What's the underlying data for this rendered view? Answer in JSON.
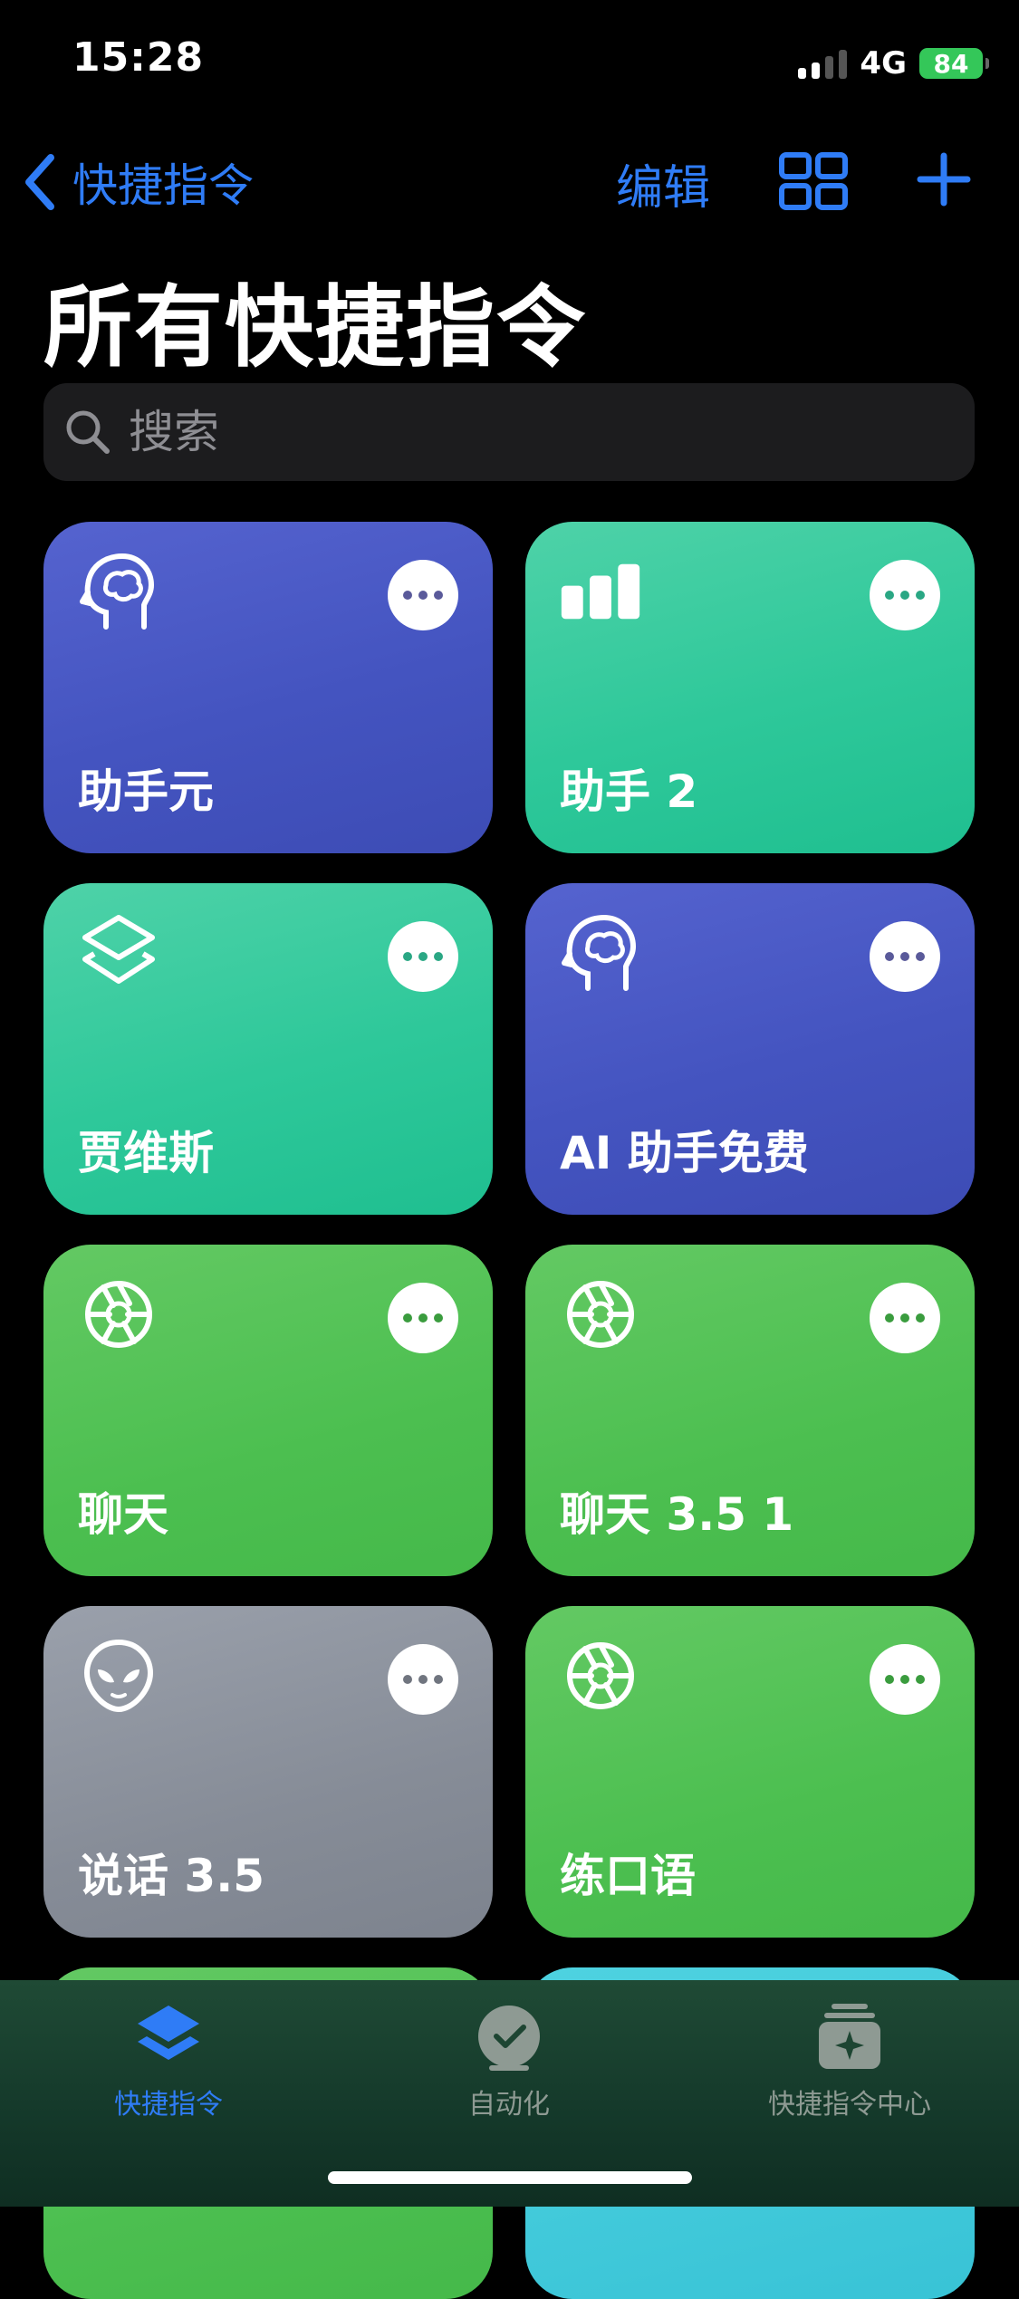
{
  "status": {
    "time": "15:28",
    "network": "4G",
    "battery": "84"
  },
  "nav": {
    "back_label": "快捷指令",
    "edit_label": "编辑"
  },
  "page": {
    "title": "所有快捷指令"
  },
  "search": {
    "placeholder": "搜索"
  },
  "shortcuts": [
    {
      "label": "助手元",
      "icon": "brain-head-icon",
      "color": "#4454c0"
    },
    {
      "label": "助手 2",
      "icon": "chart-bars-icon",
      "color": "#2ec89a"
    },
    {
      "label": "贾维斯",
      "icon": "layers-icon",
      "color": "#2ec89a"
    },
    {
      "label": "AI 助手免费",
      "icon": "brain-head-icon",
      "color": "#4454c0"
    },
    {
      "label": "聊天",
      "icon": "aperture-icon",
      "color": "#4cbf50"
    },
    {
      "label": "聊天 3.5 1",
      "icon": "aperture-icon",
      "color": "#4cbf50"
    },
    {
      "label": "说话 3.5",
      "icon": "alien-icon",
      "color": "#868c97"
    },
    {
      "label": "练口语",
      "icon": "aperture-icon",
      "color": "#4cbf50"
    }
  ],
  "tabs": [
    {
      "label": "快捷指令",
      "active": true,
      "icon": "layers-icon"
    },
    {
      "label": "自动化",
      "active": false,
      "icon": "clock-check-icon"
    },
    {
      "label": "快捷指令中心",
      "active": false,
      "icon": "gallery-sparkle-icon"
    }
  ],
  "colors": {
    "accent": "#2f7cf6",
    "tab_inactive": "#8e9a93"
  }
}
